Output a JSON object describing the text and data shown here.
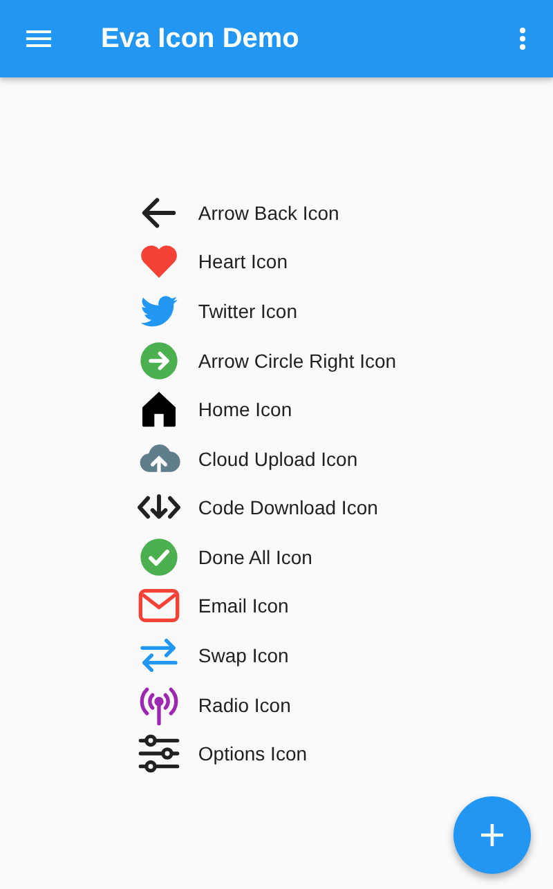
{
  "app_bar": {
    "title": "Eva Icon Demo"
  },
  "items": [
    {
      "kind": "arrow-back",
      "label": "Arrow Back Icon",
      "color": "#212121"
    },
    {
      "kind": "heart",
      "label": "Heart Icon",
      "color": "#f44336"
    },
    {
      "kind": "bird",
      "label": "Twitter Icon",
      "color": "#2196f3"
    },
    {
      "kind": "arrow-circle-right",
      "label": "Arrow Circle Right Icon",
      "color": "#4caf50"
    },
    {
      "kind": "home",
      "label": "Home Icon",
      "color": "#000000"
    },
    {
      "kind": "cloud-upload",
      "label": "Cloud Upload Icon",
      "color": "#607d8b"
    },
    {
      "kind": "code-download",
      "label": "Code Download Icon",
      "color": "#212121"
    },
    {
      "kind": "check-circle",
      "label": "Done All Icon",
      "color": "#4caf50"
    },
    {
      "kind": "email",
      "label": "Email Icon",
      "color": "#f44336"
    },
    {
      "kind": "swap",
      "label": "Swap Icon",
      "color": "#2196f3"
    },
    {
      "kind": "radio",
      "label": "Radio Icon",
      "color": "#9c27b0"
    },
    {
      "kind": "options",
      "label": "Options Icon",
      "color": "#212121"
    }
  ]
}
